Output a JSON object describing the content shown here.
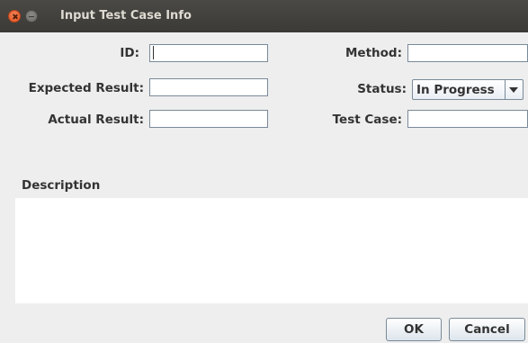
{
  "window": {
    "title": "Input Test Case Info"
  },
  "form": {
    "id": {
      "label": "ID:",
      "value": ""
    },
    "method": {
      "label": "Method:",
      "value": ""
    },
    "expected_result": {
      "label": "Expected Result:",
      "value": ""
    },
    "status": {
      "label": "Status:",
      "selected": "In Progress"
    },
    "actual_result": {
      "label": "Actual Result:",
      "value": ""
    },
    "test_case": {
      "label": "Test Case:",
      "value": ""
    }
  },
  "description": {
    "title": "Description",
    "value": ""
  },
  "buttons": {
    "ok": "OK",
    "cancel": "Cancel"
  },
  "colors": {
    "titlebar": "#3b3a36",
    "close_button": "#e2501f",
    "window_background": "#eeeeee",
    "field_border": "#7a8a99"
  },
  "icons": {
    "close": "close-icon",
    "minimize": "minimize-icon",
    "dropdown": "chevron-down-icon"
  }
}
